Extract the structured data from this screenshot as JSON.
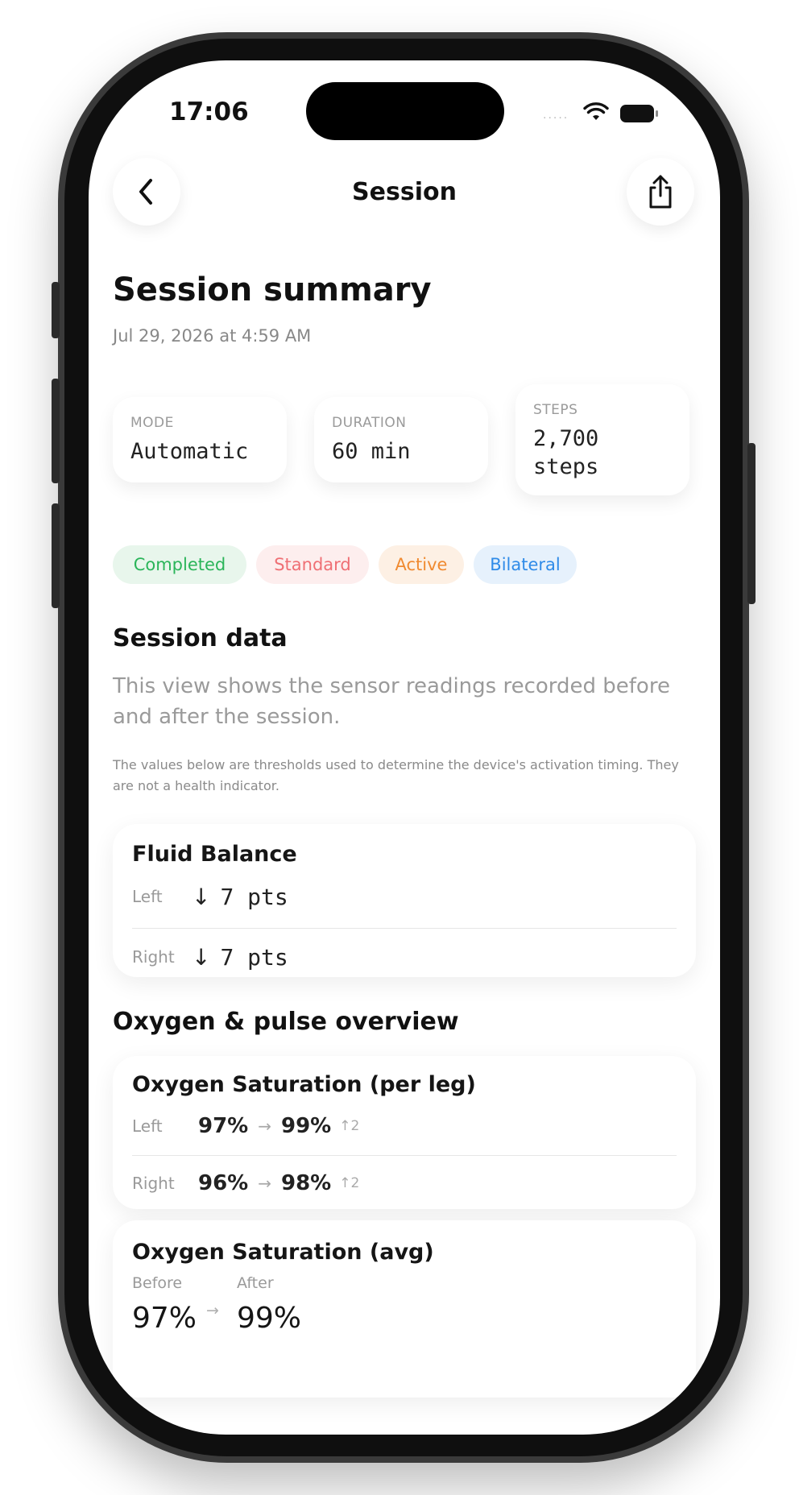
{
  "status": {
    "time": "17:06",
    "signal": ".....",
    "icons": [
      "wifi-icon",
      "battery-icon"
    ]
  },
  "nav": {
    "title": "Session",
    "back_icon": "chevron-left-icon",
    "share_icon": "share-icon"
  },
  "header": {
    "title": "Session summary",
    "date": "Jul 29, 2026 at 4:59 AM"
  },
  "stats": [
    {
      "label": "MODE",
      "value": "Automatic"
    },
    {
      "label": "DURATION",
      "value": "60 min"
    },
    {
      "label": "STEPS",
      "value": "2,700\nsteps"
    }
  ],
  "badges": [
    {
      "label": "Completed",
      "color": "#2bb55a",
      "bg": "#e8f6ec"
    },
    {
      "label": "Standard",
      "color": "#ef6f74",
      "bg": "#fdeeee"
    },
    {
      "label": "Active",
      "color": "#f08a30",
      "bg": "#fdf0e4"
    },
    {
      "label": "Bilateral",
      "color": "#2f8be8",
      "bg": "#e6f1fc"
    }
  ],
  "session_data": {
    "title": "Session data",
    "description": "This view shows the sensor readings recorded before and after the session.",
    "note": "The values below are thresholds used to determine the device's activation timing. They are not a health indicator."
  },
  "fluid_balance": {
    "title": "Fluid Balance",
    "rows": [
      {
        "label": "Left",
        "arrow": "↓",
        "value": "7 pts"
      },
      {
        "label": "Right",
        "arrow": "↓",
        "value": "7 pts"
      }
    ]
  },
  "oxygen_section": {
    "title": "Oxygen & pulse overview"
  },
  "oxygen_per_leg": {
    "title": "Oxygen Saturation (per leg)",
    "rows": [
      {
        "label": "Left",
        "before": "97%",
        "arrow": "→",
        "after": "99%",
        "delta": "↑2"
      },
      {
        "label": "Right",
        "before": "96%",
        "arrow": "→",
        "after": "98%",
        "delta": "↑2"
      }
    ]
  },
  "oxygen_avg": {
    "title": "Oxygen Saturation (avg)",
    "before_label": "Before",
    "after_label": "After",
    "before": "97%",
    "arrow": "→",
    "after": "99%"
  }
}
